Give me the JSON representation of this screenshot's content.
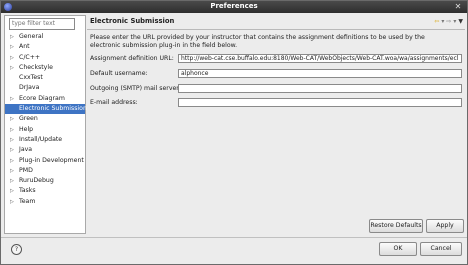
{
  "window": {
    "title": "Preferences"
  },
  "sidebar": {
    "filter_placeholder": "type filter text",
    "items": [
      {
        "label": "General",
        "expandable": true
      },
      {
        "label": "Ant",
        "expandable": true
      },
      {
        "label": "C/C++",
        "expandable": true
      },
      {
        "label": "Checkstyle",
        "expandable": true
      },
      {
        "label": "CxxTest",
        "expandable": false
      },
      {
        "label": "DrJava",
        "expandable": false
      },
      {
        "label": "Ecore Diagram",
        "expandable": true
      },
      {
        "label": "Electronic Submission",
        "expandable": false,
        "selected": true
      },
      {
        "label": "Green",
        "expandable": true
      },
      {
        "label": "Help",
        "expandable": true
      },
      {
        "label": "Install/Update",
        "expandable": true
      },
      {
        "label": "Java",
        "expandable": true
      },
      {
        "label": "Plug-in Development",
        "expandable": true
      },
      {
        "label": "PMD",
        "expandable": true
      },
      {
        "label": "RuruDebug",
        "expandable": true
      },
      {
        "label": "Tasks",
        "expandable": true
      },
      {
        "label": "Team",
        "expandable": true
      }
    ]
  },
  "main": {
    "heading": "Electronic Submission",
    "description": "Please enter the URL provided by your instructor that contains the assignment definitions to be used by the electronic submission plug-in in the field below.",
    "fields": {
      "assignment_label": "Assignment definition URL:",
      "assignment_value": "http://web-cat.cse.buffalo.edu:8180/Web-CAT/WebObjects/Web-CAT.woa/wa/assignments/eclipse",
      "username_label": "Default username:",
      "username_value": "alphonce",
      "smtp_label": "Outgoing (SMTP) mail server:",
      "smtp_value": "",
      "email_label": "E-mail address:",
      "email_value": ""
    },
    "restore_defaults": "Restore Defaults",
    "apply": "Apply"
  },
  "footer": {
    "help": "?",
    "ok": "OK",
    "cancel": "Cancel"
  }
}
